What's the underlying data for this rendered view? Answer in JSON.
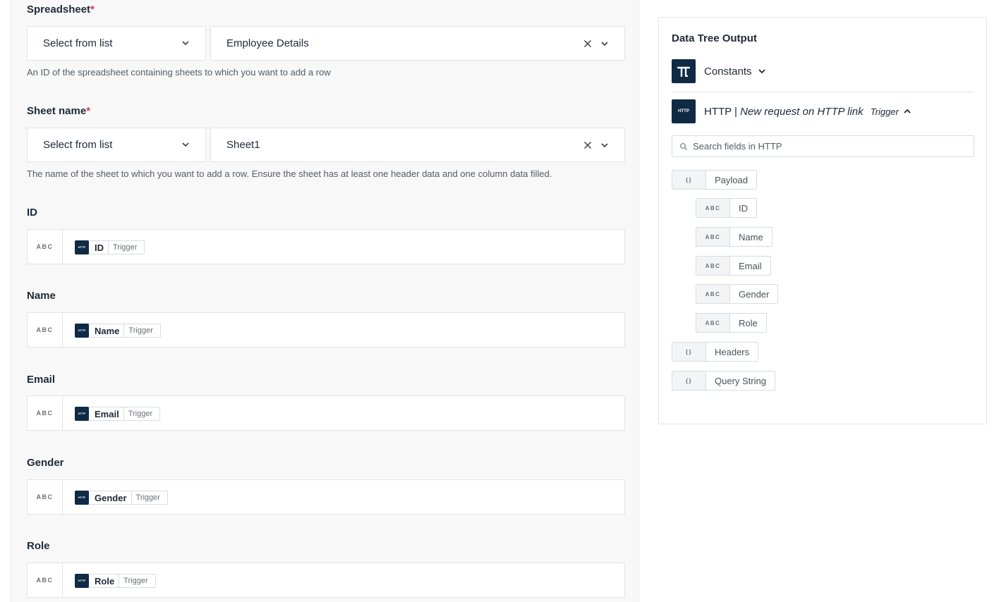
{
  "form": {
    "spreadsheet": {
      "label": "Spreadsheet",
      "required": "*",
      "mode": "Select from list",
      "value": "Employee Details",
      "help": "An ID of the spreadsheet containing sheets to which you want to add a row"
    },
    "sheet_name": {
      "label": "Sheet name",
      "required": "*",
      "mode": "Select from list",
      "value": "Sheet1",
      "help": "The name of the sheet to which you want to add a row. Ensure the sheet has at least one header data and one column data filled."
    },
    "mappings": [
      {
        "label": "ID",
        "type": "ABC",
        "token": "ID",
        "tag": "Trigger",
        "icon": "HTTP"
      },
      {
        "label": "Name",
        "type": "ABC",
        "token": "Name",
        "tag": "Trigger",
        "icon": "HTTP"
      },
      {
        "label": "Email",
        "type": "ABC",
        "token": "Email",
        "tag": "Trigger",
        "icon": "HTTP"
      },
      {
        "label": "Gender",
        "type": "ABC",
        "token": "Gender",
        "tag": "Trigger",
        "icon": "HTTP"
      },
      {
        "label": "Role",
        "type": "ABC",
        "token": "Role",
        "tag": "Trigger",
        "icon": "HTTP"
      }
    ]
  },
  "data_tree": {
    "title": "Data Tree Output",
    "constants": {
      "label": "Constants",
      "icon": "pi-icon"
    },
    "http": {
      "icon_text": "HTTP",
      "prefix": "HTTP | ",
      "event": "New request on HTTP link",
      "tag": "Trigger"
    },
    "search_placeholder": "Search fields in HTTP",
    "nodes": [
      {
        "type": "{}",
        "label": "Payload"
      },
      {
        "type": "ABC",
        "label": "ID"
      },
      {
        "type": "ABC",
        "label": "Name"
      },
      {
        "type": "ABC",
        "label": "Email"
      },
      {
        "type": "ABC",
        "label": "Gender"
      },
      {
        "type": "ABC",
        "label": "Role"
      },
      {
        "type": "{}",
        "label": "Headers"
      },
      {
        "type": "{}",
        "label": "Query String"
      }
    ]
  },
  "colors": {
    "accent_dark": "#0f2a45",
    "required": "#d8345f"
  }
}
